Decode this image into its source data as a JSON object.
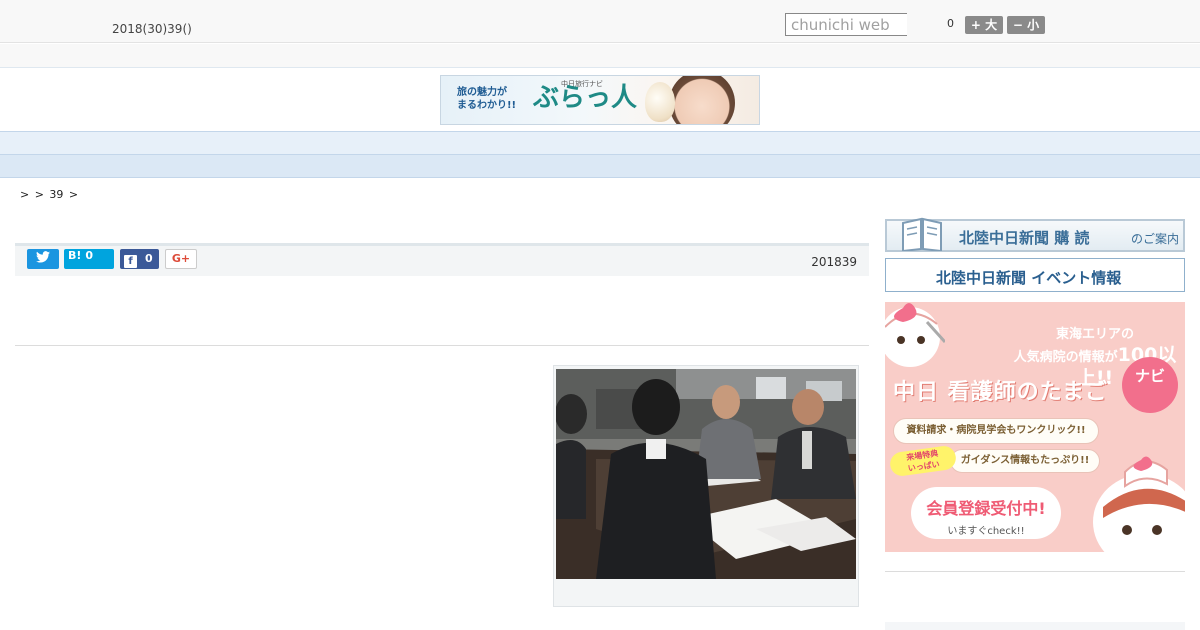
{
  "header": {
    "date": "2018(30)39()",
    "search_placeholder": "chunichi web",
    "font_size_count": "0",
    "font_larger_label": "+ 大",
    "font_smaller_label": "− 小"
  },
  "banner": {
    "copy_line1": "旅の魅力が",
    "copy_line2": "まるわかり!!",
    "sub": "中日旅行ナビ",
    "logo": "ぶらっ人"
  },
  "nav": {
    "items": [
      "",
      "",
      "",
      "",
      "",
      "",
      "",
      "",
      ""
    ]
  },
  "breadcrumb": {
    "text": ">  > 39 >"
  },
  "article": {
    "published": "201839",
    "share": {
      "hatena_label": "B!",
      "hatena_count": "0",
      "facebook_count": "0",
      "gplus_label": "G+"
    }
  },
  "sidebar": {
    "subscribe_title": "北陸中日新聞",
    "subscribe_bold": "購 読",
    "subscribe_suffix": "のご案内",
    "event_label": "北陸中日新聞 イベント情報",
    "ad": {
      "line1": "東海エリアの",
      "line2a": "人気病院の情報が",
      "line2b": "100以上!!",
      "title": "中日 看護師のたまご",
      "badge": "ナビ",
      "pill1": "資料請求・病院見学会もワンクリック!!",
      "tag_line1": "来場特典",
      "tag_line2": "いっぱい",
      "pill2": "ガイダンス情報もたっぷり!!",
      "cta_main": "会員登録受付中!",
      "cta_sub": "いますぐcheck!!"
    }
  },
  "colors": {
    "nav_bg": "#e7f0f9",
    "twitter": "#1b95e0",
    "hatena": "#00a4de",
    "facebook": "#3b5998",
    "ad_bg": "#f9cdc8"
  }
}
